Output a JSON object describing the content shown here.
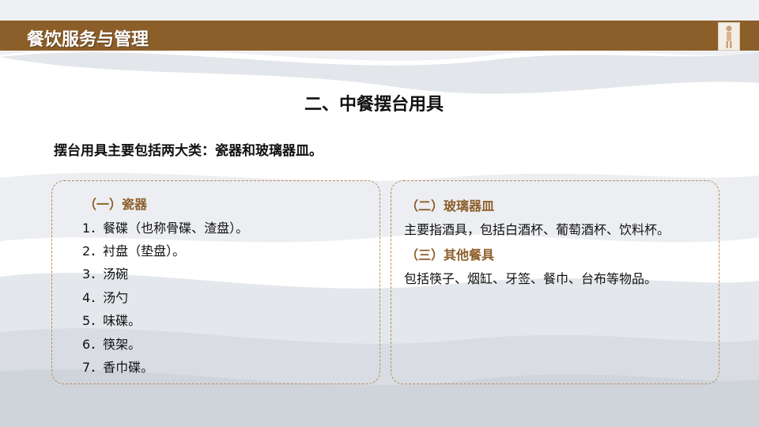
{
  "header": {
    "title": "餐饮服务与管理"
  },
  "slide": {
    "title": "二、中餐摆台用具",
    "intro": "摆台用具主要包括两大类：瓷器和玻璃器皿。"
  },
  "left_panel": {
    "heading": "（一）瓷器",
    "items": [
      "1．餐碟（也称骨碟、渣盘）。",
      "2．衬盘（垫盘）。",
      "3．汤碗",
      "4．汤勺",
      "5．味碟。",
      "6．筷架。",
      "7．香巾碟。"
    ]
  },
  "right_panel": {
    "heading_glass": "（二）玻璃器皿",
    "glass_text": "主要指酒具，包括白酒杯、葡萄酒杯、饮料杯。",
    "heading_other": "（三）其他餐具",
    "other_text": "包括筷子、烟缸、牙签、餐巾、台布等物品。"
  },
  "colors": {
    "header_bar": "#8c5e2a",
    "accent_heading": "#8c5e2a",
    "panel_border": "#b88a5e",
    "wave_gray": "#d9dde3"
  },
  "icons": {
    "header_figure": "decorative-figure-icon"
  }
}
